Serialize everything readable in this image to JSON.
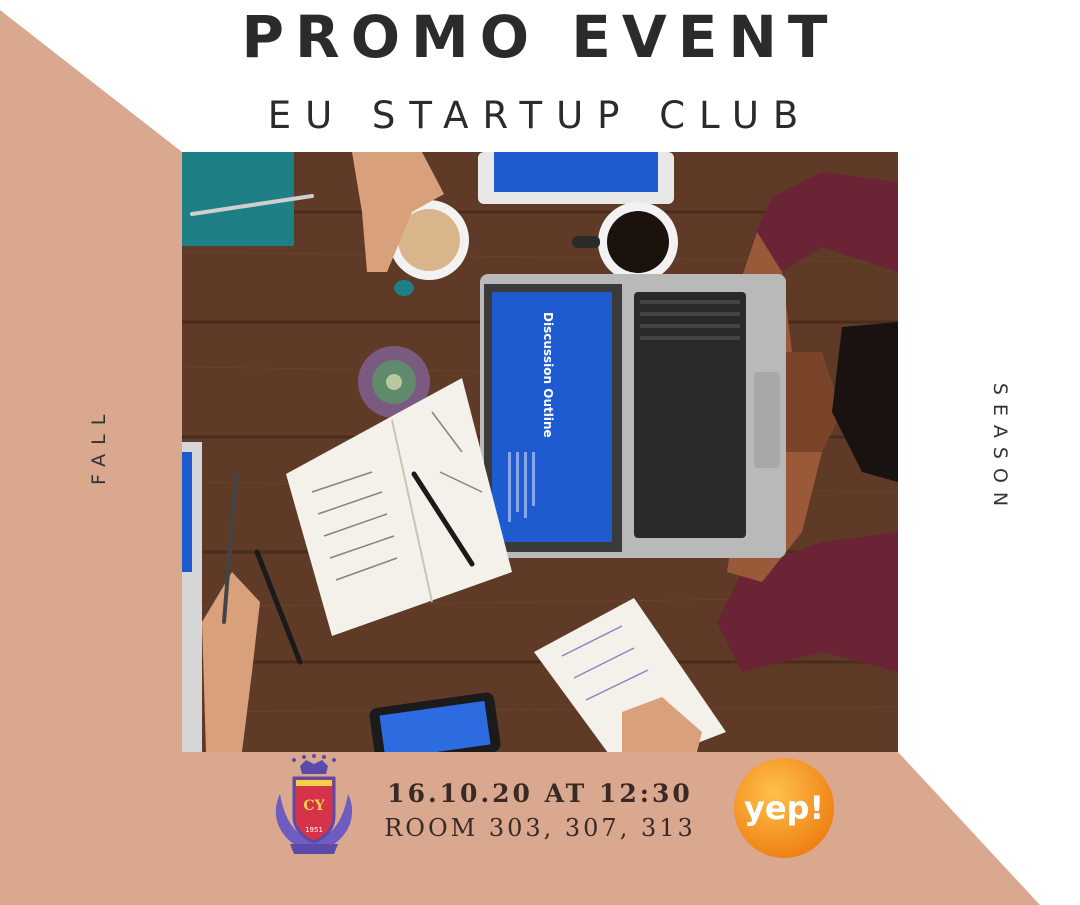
{
  "poster": {
    "title": "PROMO EVENT",
    "subtitle": "EU STARTUP CLUB",
    "side_left": "FALL",
    "side_right": "SEASON",
    "date_time": "16.10.20 AT 12:30",
    "rooms": "ROOM 303, 307, 313",
    "sponsor_logo_text": "yep!",
    "crest_text": "1951"
  },
  "laptop_screen": {
    "heading": "Discussion Outline"
  },
  "colors": {
    "peach": "#d9a88f",
    "text_dark": "#2b2b2b",
    "wood": "#5e3a27",
    "screen_blue": "#1e5bd0",
    "yep_orange": "#f39a1e",
    "crest_purple": "#5b4aa8"
  }
}
